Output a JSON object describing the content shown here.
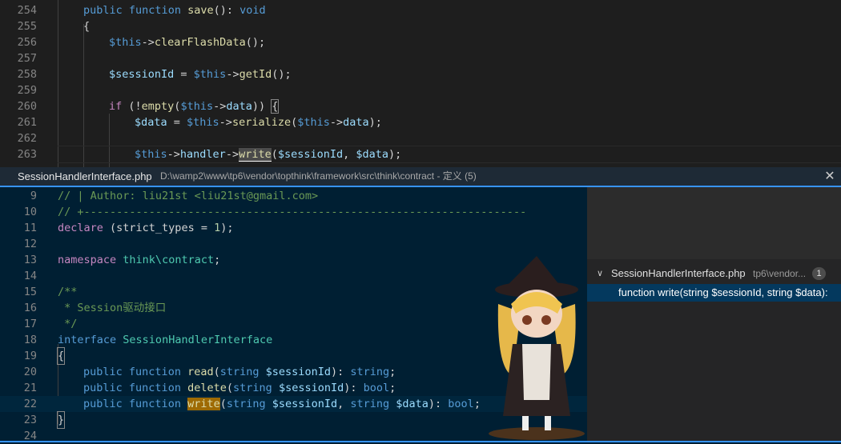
{
  "colors": {
    "accent": "#3794ff",
    "peek_background": "#001f33",
    "match_highlight": "#9e6a03"
  },
  "editor": {
    "lines": [
      {
        "num": "254",
        "code": "public function save(): void"
      },
      {
        "num": "255",
        "code": "{"
      },
      {
        "num": "256",
        "code": "$this->clearFlashData();"
      },
      {
        "num": "257",
        "code": ""
      },
      {
        "num": "258",
        "code": "$sessionId = $this->getId();"
      },
      {
        "num": "259",
        "code": ""
      },
      {
        "num": "260",
        "code": "if (!empty($this->data)) {"
      },
      {
        "num": "261",
        "code": "$data = $this->serialize($this->data);"
      },
      {
        "num": "262",
        "code": ""
      },
      {
        "num": "263",
        "code": "$this->handler->write($sessionId, $data);"
      }
    ]
  },
  "peek": {
    "header_file": "SessionHandlerInterface.php",
    "header_path": "D:\\wamp2\\www\\tp6\\vendor\\topthink\\framework\\src\\think\\contract - 定义 (5)",
    "close_icon": "close-icon",
    "lines": [
      {
        "num": "9",
        "code": "// | Author: liu21st <liu21st@gmail.com>"
      },
      {
        "num": "10",
        "code": "// +--------------------------------------------------------------------"
      },
      {
        "num": "11",
        "code": "declare (strict_types = 1);"
      },
      {
        "num": "12",
        "code": ""
      },
      {
        "num": "13",
        "code": "namespace think\\contract;"
      },
      {
        "num": "14",
        "code": ""
      },
      {
        "num": "15",
        "code": "/**"
      },
      {
        "num": "16",
        "code": " * Session驱动接口"
      },
      {
        "num": "17",
        "code": " */"
      },
      {
        "num": "18",
        "code": "interface SessionHandlerInterface"
      },
      {
        "num": "19",
        "code": "{"
      },
      {
        "num": "20",
        "code": "public function read(string $sessionId): string;"
      },
      {
        "num": "21",
        "code": "public function delete(string $sessionId): bool;"
      },
      {
        "num": "22",
        "code": "public function write(string $sessionId, string $data): bool;"
      },
      {
        "num": "23",
        "code": "}"
      },
      {
        "num": "24",
        "code": ""
      }
    ],
    "references": {
      "file": "SessionHandlerInterface.php",
      "dir": "tp6\\vendor...",
      "count": "1",
      "item": "function write(string $sessionId, string $data):"
    }
  }
}
